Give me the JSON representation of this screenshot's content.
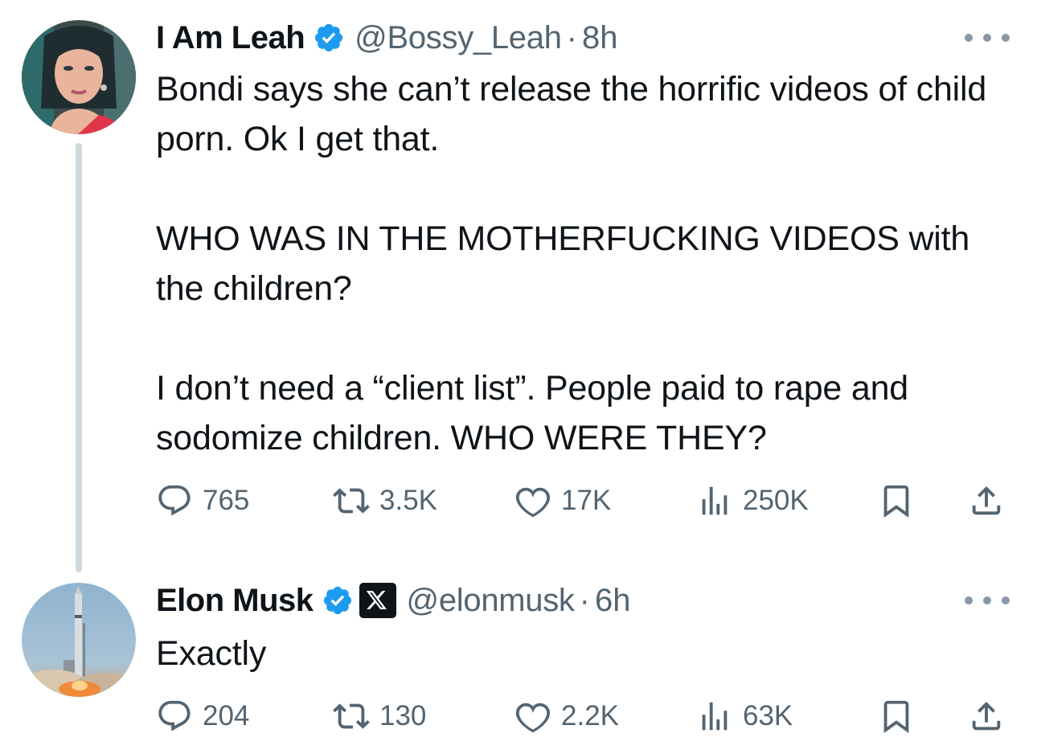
{
  "tweets": [
    {
      "display_name": "I Am Leah",
      "handle": "@Bossy_Leah",
      "separator": "·",
      "time": "8h",
      "verified": true,
      "paragraphs": [
        "Bondi says she can’t release the horrific videos of child porn. Ok I get that.",
        "WHO WAS IN THE MOTHERFUCKING VIDEOS with the children?",
        "I don’t need a “client list”. People paid to rape and sodomize children. WHO WERE THEY?"
      ],
      "stats": {
        "replies": "765",
        "retweets": "3.5K",
        "likes": "17K",
        "views": "250K"
      }
    },
    {
      "display_name": "Elon Musk",
      "handle": "@elonmusk",
      "separator": "·",
      "time": "6h",
      "verified": true,
      "affiliate_icon": "x-logo-icon",
      "paragraphs": [
        "Exactly"
      ],
      "stats": {
        "replies": "204",
        "retweets": "130",
        "likes": "2.2K",
        "views": "63K"
      }
    }
  ],
  "icons": [
    "more-icon",
    "reply-icon",
    "retweet-icon",
    "like-icon",
    "views-icon",
    "bookmark-icon",
    "share-icon",
    "verified-badge-icon",
    "x-logo-icon"
  ],
  "colors": {
    "text": "#0f1419",
    "secondary": "#536471",
    "verified": "#1d9bf0",
    "thread_line": "#cfd9de"
  }
}
